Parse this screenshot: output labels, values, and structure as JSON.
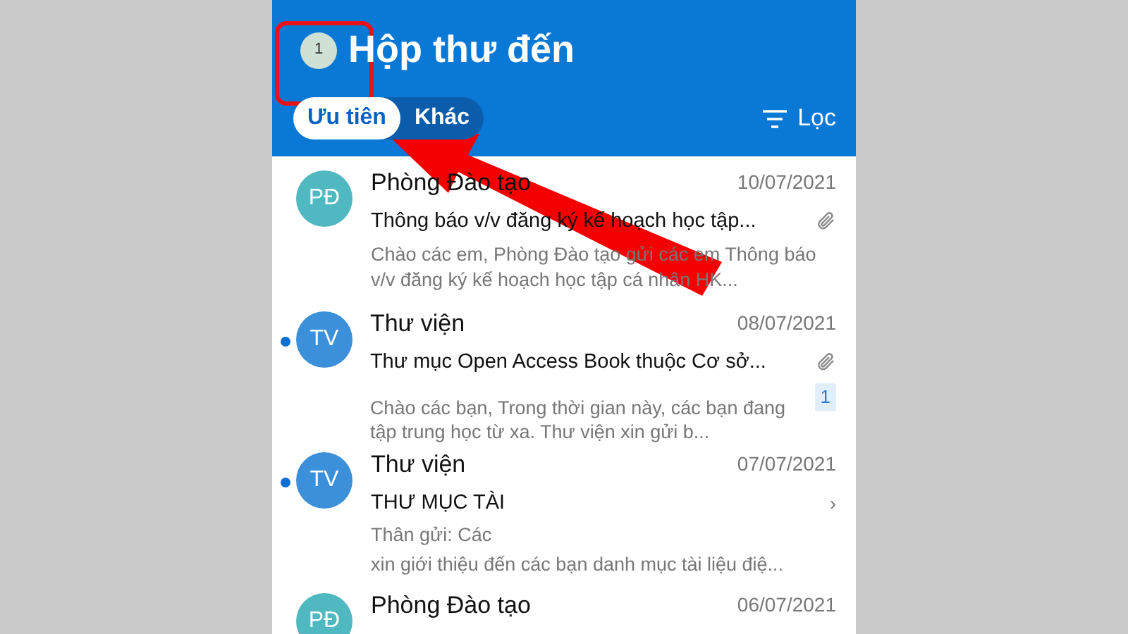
{
  "header": {
    "account_badge": "1",
    "title": "Hộp thư đến",
    "tabs": [
      {
        "label": "Ưu tiên",
        "selected": true
      },
      {
        "label": "Khác",
        "selected": false
      }
    ],
    "filter": "Lọc"
  },
  "messages": [
    {
      "initials": "PĐ",
      "color": "#4fb8c1",
      "sender": "Phòng Đào tạo",
      "date": "10/07/2021",
      "unread": false,
      "subject": "Thông báo v/v đăng ký kế hoạch học tập...",
      "preview": "Chào các em, Phòng Đào tạo gửi các em Thông báo v/v đăng ký kế hoạch học tập cá nhân HK...",
      "attachment": true
    },
    {
      "initials": "TV",
      "color": "#3b90d9",
      "sender": "Thư viện",
      "date": "08/07/2021",
      "unread": true,
      "subject": "Thư mục Open Access Book thuộc Cơ sở...",
      "preview": "Chào các bạn, Trong thời gian này, các bạn đang tập trung học từ xa. Thư viện xin gửi b...",
      "attachment": true,
      "count": "1"
    },
    {
      "initials": "TV",
      "color": "#3b90d9",
      "sender": "Thư viện",
      "date": "07/07/2021",
      "unread": true,
      "subject": "THƯ MỤC TÀI",
      "preview_lines": [
        "Thân gửi: Các",
        "xin giới thiệu đến các bạn danh mục tài liệu điệ..."
      ],
      "attachment": false,
      "mark": "›"
    },
    {
      "initials": "PĐ",
      "color": "#4fb8c1",
      "sender": "Phòng Đào tạo",
      "date": "06/07/2021",
      "unread": false,
      "attachment": false
    }
  ]
}
